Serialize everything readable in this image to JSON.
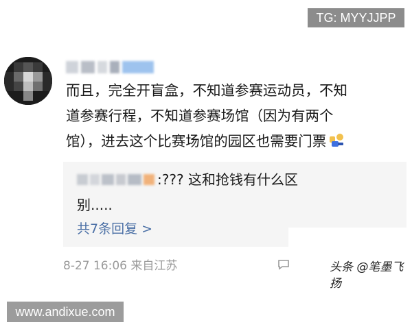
{
  "overlay": {
    "tg_label": "TG: MYYJJPP",
    "site_label": "www.andixue.com"
  },
  "comment": {
    "line1": "而且，完全开盲盒，不知道参赛运动员，不知",
    "line2": "道参赛行程，不知道参赛场馆（因为有两个",
    "line3": "馆），进去这个比赛场馆的园区也需要门票",
    "emoji": "thumbs-up-emoji"
  },
  "reply": {
    "text_line1": ":??? 这和抢钱有什么区",
    "text_line2": "别.....",
    "more_replies": "共7条回复 >"
  },
  "meta": {
    "timestamp": "8-27 16:06 来自江苏",
    "comment_icon": "comment-icon",
    "source_watermark": "头条 @笔墨飞扬"
  },
  "colors": {
    "link": "#4a6fa5",
    "meta_gray": "#9a9a9a",
    "reply_bg": "#f5f5f5",
    "badge_bg": "#8c8c8c"
  }
}
